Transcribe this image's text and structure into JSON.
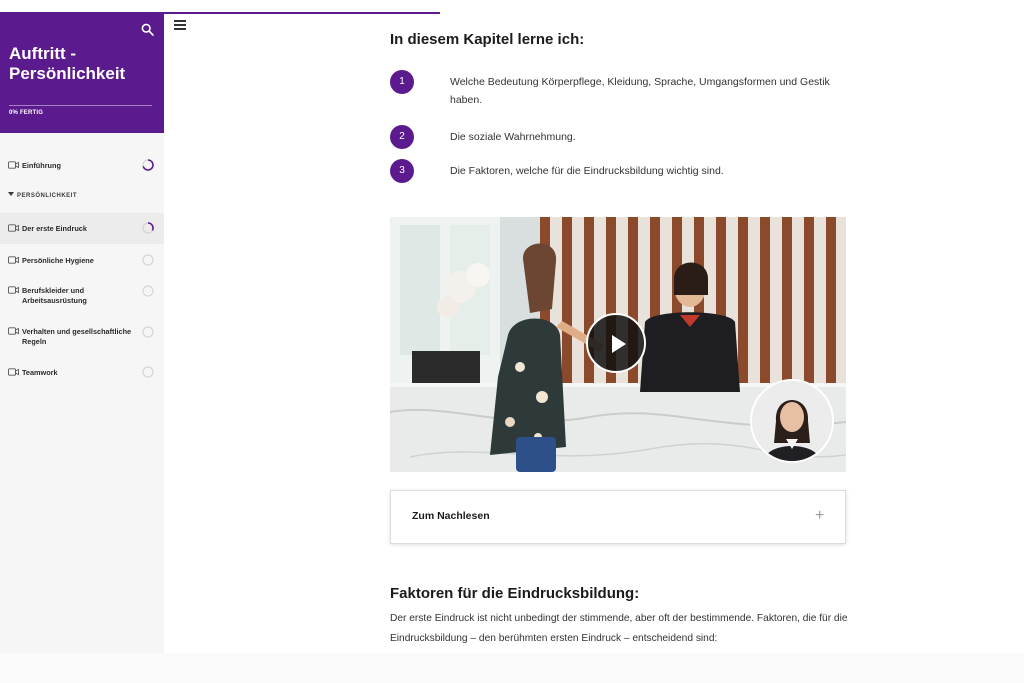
{
  "sidebar": {
    "course_title": "Auftritt - Persönlichkeit",
    "progress_text": "0% FERTIG",
    "section_label": "PERSÖNLICHKEIT",
    "items": [
      {
        "label": "Einführung",
        "state": "in-progress"
      },
      {
        "label": "Der erste Eindruck",
        "state": "in-progress"
      },
      {
        "label": "Persönliche Hygiene",
        "state": "not-started"
      },
      {
        "label": "Berufskleider und Arbeitsausrüstung",
        "state": "not-started"
      },
      {
        "label": "Verhalten und gesellschaftliche Regeln",
        "state": "not-started"
      },
      {
        "label": "Teamwork",
        "state": "not-started"
      }
    ]
  },
  "main": {
    "chapter_heading": "In diesem Kapitel lerne ich:",
    "steps": [
      {
        "num": "1",
        "text": "Welche Bedeutung Körperpflege, Kleidung, Sprache, Umgangsformen und Gestik haben."
      },
      {
        "num": "2",
        "text": "Die soziale Wahrnehmung."
      },
      {
        "num": "3",
        "text": "Die Faktoren, welche für die Eindrucksbildung wichtig sind."
      }
    ],
    "accordion_title": "Zum Nachlesen",
    "accordion_icon": "+",
    "faktoren_heading": "Faktoren für die Eindrucksbildung:",
    "faktoren_text": "Der erste Eindruck ist nicht unbedingt der stimmende, aber oft der bestimmende. Faktoren, die für die Eindrucksbildung – den berühmten ersten Eindruck – entscheidend sind:"
  },
  "colors": {
    "brand": "#5b1a8e",
    "sidebar_bg": "#f6f6f6"
  },
  "icons": {
    "search": "search-icon",
    "menu": "hamburger-menu-icon",
    "lesson": "video-camera-icon",
    "play": "play-icon"
  }
}
